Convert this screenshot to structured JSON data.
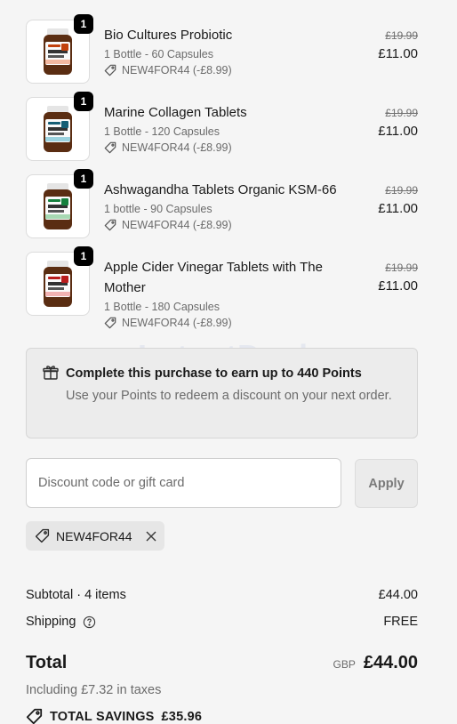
{
  "items": [
    {
      "qty": "1",
      "name": "Bio Cultures Probiotic",
      "variant": "1 Bottle - 60 Capsules",
      "discount": "NEW4FOR44 (-£8.99)",
      "old_price": "£19.99",
      "price": "£11.00",
      "cap_color": "#c2410c",
      "label_color": "#f2b8a0"
    },
    {
      "qty": "1",
      "name": "Marine Collagen Tablets",
      "variant": "1 Bottle - 120 Capsules",
      "discount": "NEW4FOR44 (-£8.99)",
      "old_price": "£19.99",
      "price": "£11.00",
      "cap_color": "#155e75",
      "label_color": "#9bd2de"
    },
    {
      "qty": "1",
      "name": "Ashwagandha Tablets Organic KSM-66",
      "variant": "1 bottle - 90 Capsules",
      "discount": "NEW4FOR44 (-£8.99)",
      "old_price": "£19.99",
      "price": "£11.00",
      "cap_color": "#15803d",
      "label_color": "#a7d9b3"
    },
    {
      "qty": "1",
      "name": "Apple Cider Vinegar Tablets with The Mother",
      "variant": "1 Bottle - 180 Capsules",
      "discount": "NEW4FOR44 (-£8.99)",
      "old_price": "£19.99",
      "price": "£11.00",
      "cap_color": "#b91c1c",
      "label_color": "#f1b2b2"
    }
  ],
  "points": {
    "title": "Complete this purchase to earn up to 440 Points",
    "text": "Use your Points to redeem a discount on your next order."
  },
  "discount": {
    "placeholder": "Discount code or gift card",
    "value": "",
    "apply_label": "Apply",
    "applied_code": "NEW4FOR44"
  },
  "summary": {
    "subtotal_label": "Subtotal · 4 items",
    "subtotal_value": "£44.00",
    "shipping_label": "Shipping",
    "shipping_value": "FREE",
    "total_label": "Total",
    "currency": "GBP",
    "total_value": "£44.00",
    "taxes": "Including £7.32 in taxes",
    "savings_label": "TOTAL SAVINGS",
    "savings_value": "£35.96"
  },
  "watermark": "LatestDeals"
}
